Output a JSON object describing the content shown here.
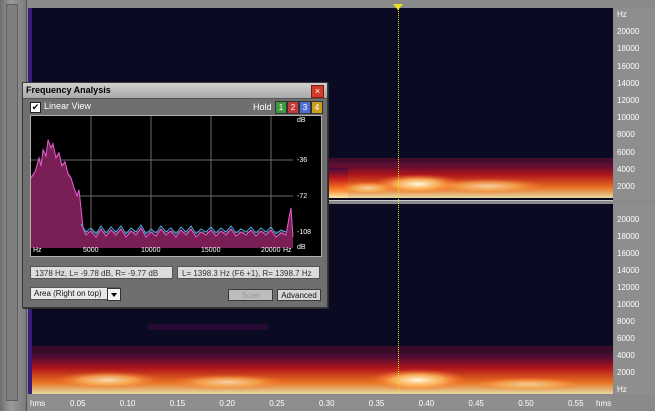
{
  "freq_axis_top": [
    "Hz",
    "20000",
    "18000",
    "16000",
    "14000",
    "12000",
    "10000",
    "8000",
    "6000",
    "4000",
    "2000"
  ],
  "freq_axis_bottom": [
    "20000",
    "18000",
    "16000",
    "14000",
    "12000",
    "10000",
    "8000",
    "6000",
    "4000",
    "2000",
    "Hz"
  ],
  "time_axis": [
    "hms",
    "0.05",
    "0.10",
    "0.15",
    "0.20",
    "0.25",
    "0.30",
    "0.35",
    "0.40",
    "0.45",
    "0.50",
    "0.55",
    "hms"
  ],
  "dialog": {
    "title": "Frequency Analysis",
    "close_glyph": "×",
    "linear_view_label": "Linear View",
    "linear_view_checked": "✔",
    "hold_label": "Hold",
    "hold_buttons": [
      "1",
      "2",
      "3",
      "4"
    ],
    "hold_colors": [
      "#3f9a3f",
      "#c23a3a",
      "#4f6fd0",
      "#c9a020"
    ],
    "y_labels": [
      "dB",
      "-36",
      "-72",
      "-108",
      "dB"
    ],
    "x_labels": [
      "Hz",
      "5000",
      "10000",
      "15000",
      "20000",
      "Hz"
    ],
    "readout_left": "1378 Hz, L= -9.78 dB, R= -9.77 dB",
    "readout_right": "L= 1398.3 Hz (F6 +1), R= 1398.7 Hz",
    "graph_type": "Area (Right on top)",
    "scan_label": "Scan",
    "advanced_label": "Advanced"
  },
  "colors": {
    "spectrogram_bg": "#0a0b22",
    "plot_fill": "#7a1f55",
    "plot_line_left": "#e060d0",
    "plot_line_right": "#4aa8e0",
    "cursor": "#e8e020"
  }
}
